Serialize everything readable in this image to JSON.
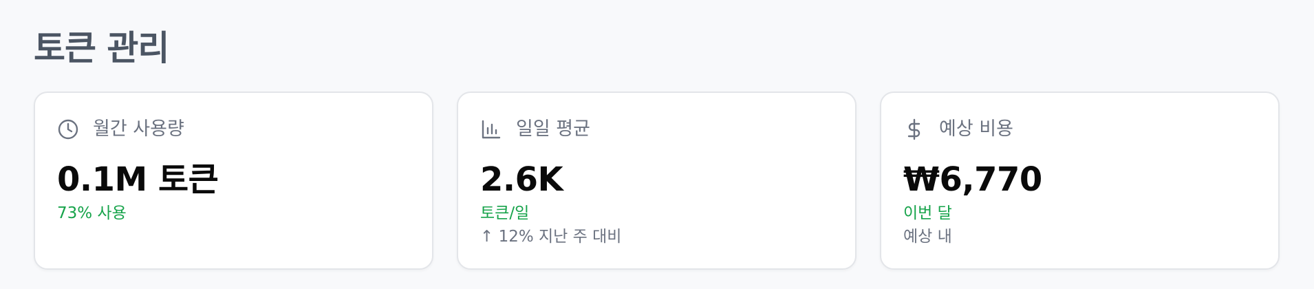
{
  "page": {
    "title": "토큰 관리"
  },
  "cards": [
    {
      "icon": "clock-icon",
      "label": "월간 사용량",
      "value": "0.1M 토큰",
      "sub": "73% 사용",
      "note": ""
    },
    {
      "icon": "bar-chart-icon",
      "label": "일일 평균",
      "value": "2.6K",
      "sub": "토큰/일",
      "note": "↑ 12% 지난 주 대비"
    },
    {
      "icon": "dollar-icon",
      "label": "예상 비용",
      "value": "₩6,770",
      "sub": "이번 달",
      "note": "예상 내"
    }
  ],
  "colors": {
    "accent_green": "#16a34a",
    "muted_text": "#6b7280",
    "title_text": "#4b5563",
    "card_border": "#e3e5e9",
    "background": "#f8f9fb"
  }
}
